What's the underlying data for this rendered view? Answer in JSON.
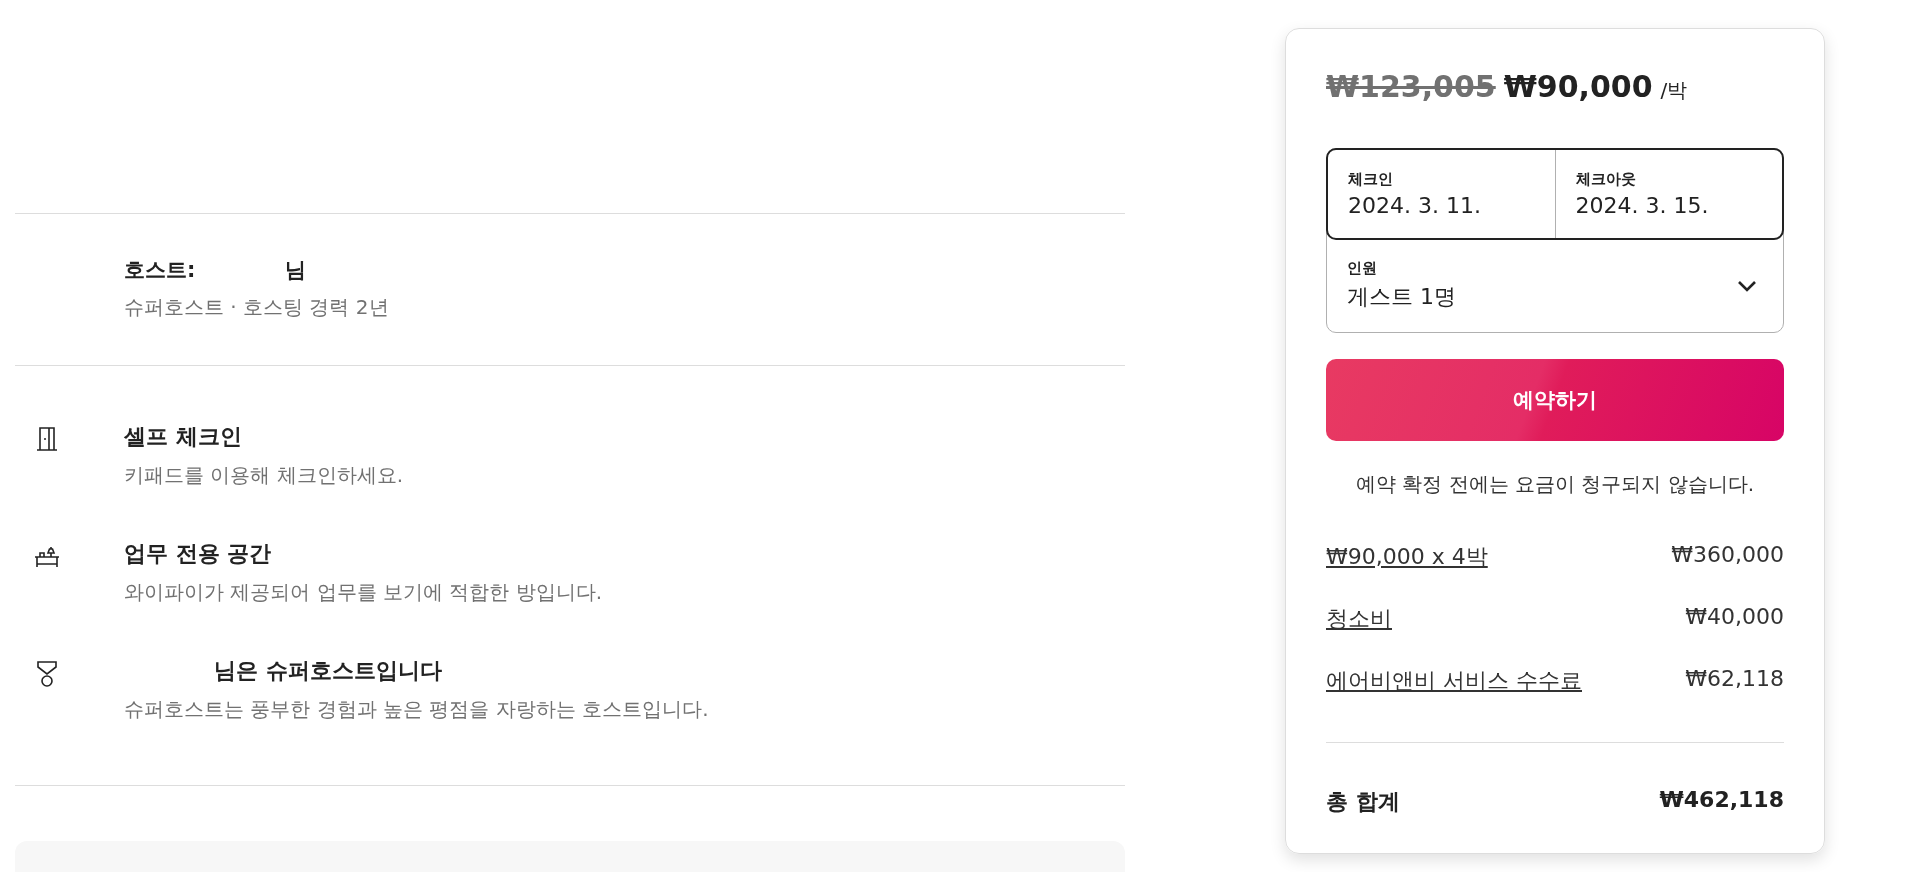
{
  "host": {
    "title_prefix": "호스트:",
    "title_suffix": "님",
    "subtitle": "슈퍼호스트 · 호스팅 경력 2년"
  },
  "features": [
    {
      "kind": "door",
      "title": "셀프 체크인",
      "description": "키패드를 이용해 체크인하세요.",
      "redacted_prefix": false
    },
    {
      "kind": "desk",
      "title": "업무 전용 공간",
      "description": "와이파이가 제공되어 업무를 보기에 적합한 방입니다.",
      "redacted_prefix": false
    },
    {
      "kind": "medal",
      "title": "님은 슈퍼호스트입니다",
      "description": "슈퍼호스트는 풍부한 경험과 높은 평점을 자랑하는 호스트입니다.",
      "redacted_prefix": true
    }
  ],
  "booking": {
    "original_price": "₩123,005",
    "price": "₩90,000",
    "per": "/박",
    "checkin": {
      "label": "체크인",
      "value": "2024. 3. 11."
    },
    "checkout": {
      "label": "체크아웃",
      "value": "2024. 3. 15."
    },
    "guests": {
      "label": "인원",
      "value": "게스트 1명"
    },
    "reserve_button": "예약하기",
    "note": "예약 확정 전에는 요금이 청구되지 않습니다.",
    "fees": [
      {
        "label": "₩90,000 x 4박",
        "amount": "₩360,000"
      },
      {
        "label": "청소비",
        "amount": "₩40,000"
      },
      {
        "label": "에어비앤비 서비스 수수료",
        "amount": "₩62,118"
      }
    ],
    "total": {
      "label": "총 합계",
      "amount": "₩462,118"
    }
  }
}
